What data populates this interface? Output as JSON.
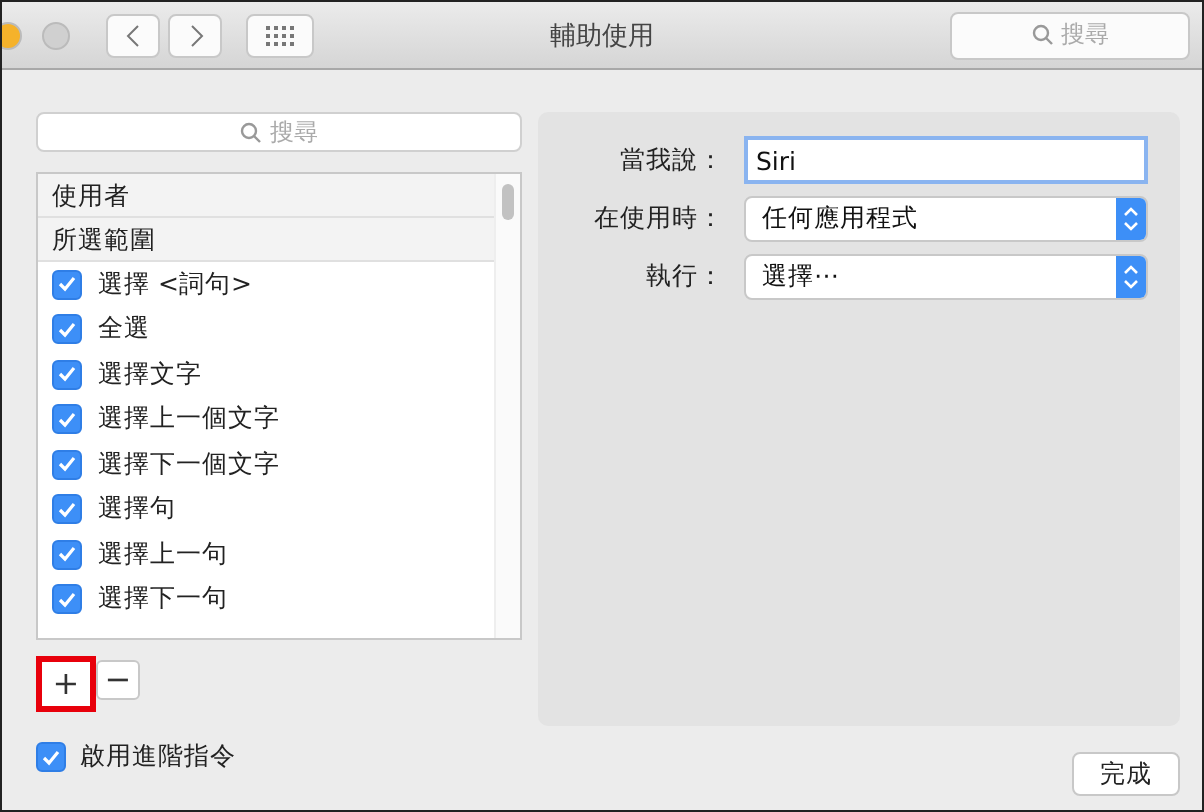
{
  "window": {
    "title": "輔助使用",
    "search": {
      "placeholder": "搜尋"
    }
  },
  "sidebar": {
    "search": {
      "placeholder": "搜尋"
    },
    "groups": [
      {
        "label": "使用者"
      },
      {
        "label": "所選範圍"
      }
    ],
    "items": [
      {
        "label": "選擇 <詞句>",
        "checked": true
      },
      {
        "label": "全選",
        "checked": true
      },
      {
        "label": "選擇文字",
        "checked": true
      },
      {
        "label": "選擇上一個文字",
        "checked": true
      },
      {
        "label": "選擇下一個文字",
        "checked": true
      },
      {
        "label": "選擇句",
        "checked": true
      },
      {
        "label": "選擇上一句",
        "checked": true
      },
      {
        "label": "選擇下一句",
        "checked": true
      }
    ],
    "add_button": "+",
    "remove_button": "−",
    "add_highlighted": true
  },
  "detail": {
    "fields": [
      {
        "kind": "text",
        "label": "當我說：",
        "value": "Siri"
      },
      {
        "kind": "popup",
        "label": "在使用時：",
        "value": "任何應用程式"
      },
      {
        "kind": "popup",
        "label": "執行：",
        "value": "選擇⋯"
      }
    ]
  },
  "advanced": {
    "label": "啟用進階指令",
    "checked": true
  },
  "done_button": "完成"
}
